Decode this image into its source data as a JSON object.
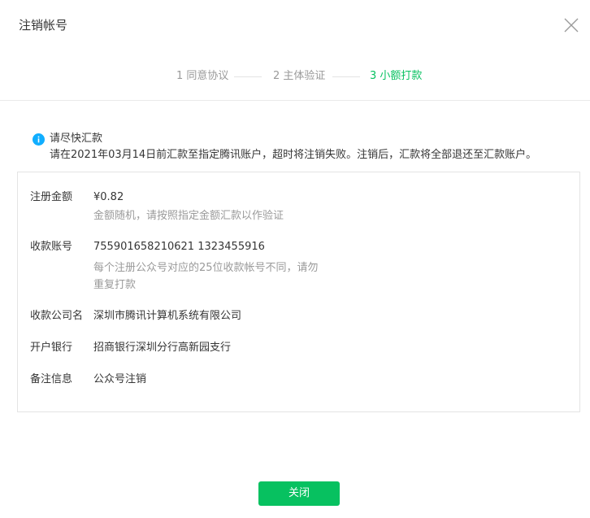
{
  "dialog": {
    "title": "注销帐号"
  },
  "steps": [
    {
      "label": "1 同意协议",
      "state": "done"
    },
    {
      "label": "2 主体验证",
      "state": "done"
    },
    {
      "label": "3 小额打款",
      "state": "active"
    }
  ],
  "notice": {
    "icon": "info-icon",
    "title": "请尽快汇款",
    "text": "请在2021年03月14日前汇款至指定腾讯账户，超时将注销失败。注销后，汇款将全部退还至汇款账户。"
  },
  "details": {
    "amount": {
      "label": "注册金额",
      "value": "¥0.82",
      "hint": "金额随机，请按照指定金额汇款以作验证"
    },
    "account": {
      "label": "收款账号",
      "value": "755901658210621 1323455916",
      "hint_line1": "每个注册公众号对应的25位收款帐号不同，请勿",
      "hint_line2": "重复打款"
    },
    "company": {
      "label": "收款公司名",
      "value": "深圳市腾讯计算机系统有限公司"
    },
    "bank": {
      "label": "开户银行",
      "value": "招商银行深圳分行高新园支行"
    },
    "remark": {
      "label": "备注信息",
      "value": "公众号注销"
    }
  },
  "footer": {
    "close_label": "关闭"
  },
  "colors": {
    "accent": "#07c160",
    "muted": "#9a9a9a",
    "info": "#10aeff"
  }
}
